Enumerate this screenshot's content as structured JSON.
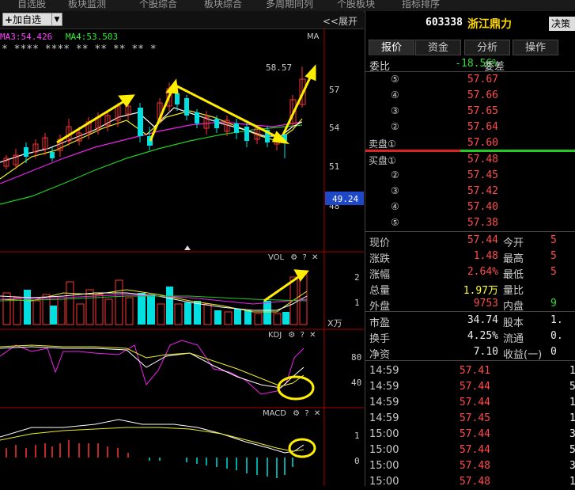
{
  "top_menu": [
    "自选股",
    "板块监测",
    "个股综合",
    "板块综合",
    "多周期同列",
    "个股板块",
    "指标排序"
  ],
  "toolbar": {
    "add_label": "加自选",
    "expand_label": "<<展开"
  },
  "ma_legend": {
    "ma3": "MA3:54.426",
    "ma4": "MA4:53.503",
    "ma": "MA"
  },
  "price_axis": {
    "labels": [
      "57",
      "54",
      "51",
      "48"
    ],
    "current": "49.24",
    "max_label": "58.57"
  },
  "star_row": "* ****  ****  **   **  **      **     *",
  "vol_panel": {
    "name": "VOL",
    "axis": [
      "2",
      "1"
    ],
    "unit": "X万"
  },
  "kdj_panel": {
    "name": "KDJ",
    "axis": [
      "80",
      "40"
    ]
  },
  "macd_panel": {
    "name": "MACD",
    "axis": [
      "1",
      "0"
    ]
  },
  "panel_icons": {
    "gear": "⚙",
    "help": "?",
    "close": "✕"
  },
  "stock": {
    "code": "603338",
    "name": "浙江鼎力",
    "decision_btn": "决策"
  },
  "tabs": [
    "报价",
    "资金",
    "分析",
    "操作"
  ],
  "weibi": {
    "label": "委比",
    "value": "-18.56%",
    "label2": "委差"
  },
  "sell": [
    {
      "label": "⑤",
      "price": "57.67"
    },
    {
      "label": "④",
      "price": "57.66"
    },
    {
      "label": "③",
      "price": "57.65"
    },
    {
      "label": "②",
      "price": "57.64"
    },
    {
      "label": "卖盘①",
      "price": "57.60"
    }
  ],
  "buy": [
    {
      "label": "买盘①",
      "price": "57.48"
    },
    {
      "label": "②",
      "price": "57.45"
    },
    {
      "label": "③",
      "price": "57.42"
    },
    {
      "label": "④",
      "price": "57.40"
    },
    {
      "label": "⑤",
      "price": "57.38"
    }
  ],
  "quote": [
    {
      "k": "现价",
      "v": "57.44",
      "k2": "今开",
      "v2": "5"
    },
    {
      "k": "涨跌",
      "v": "1.48",
      "k2": "最高",
      "v2": "5"
    },
    {
      "k": "涨幅",
      "v": "2.64%",
      "k2": "最低",
      "v2": "5"
    },
    {
      "k": "总量",
      "v": "1.97万",
      "k2": "量比",
      "v2": ""
    },
    {
      "k": "外盘",
      "v": "9753",
      "k2": "内盘",
      "v2": "9"
    },
    {
      "k": "市盈",
      "v": "34.74",
      "k2": "股本",
      "v2": "1."
    },
    {
      "k": "换手",
      "v": "4.25%",
      "k2": "流通",
      "v2": "0."
    },
    {
      "k": "净资",
      "v": "7.10",
      "k2": "收益(一)",
      "v2": "0"
    }
  ],
  "ticks": [
    {
      "t": "14:59",
      "p": "57.41",
      "n": "1"
    },
    {
      "t": "14:59",
      "p": "57.44",
      "n": "5"
    },
    {
      "t": "14:59",
      "p": "57.44",
      "n": "1"
    },
    {
      "t": "14:59",
      "p": "57.45",
      "n": "1"
    },
    {
      "t": "15:00",
      "p": "57.44",
      "n": "3"
    },
    {
      "t": "15:00",
      "p": "57.44",
      "n": "5"
    },
    {
      "t": "15:00",
      "p": "57.48",
      "n": "3"
    },
    {
      "t": "15:00",
      "p": "57.48",
      "n": "1"
    }
  ]
}
